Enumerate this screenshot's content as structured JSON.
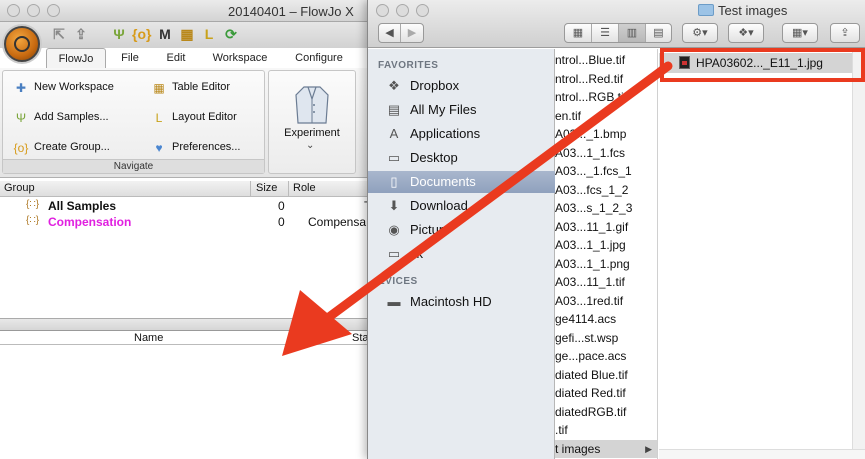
{
  "flowjo": {
    "title": "20140401 – FlowJo X",
    "tabs": [
      {
        "label": "FlowJo",
        "active": true
      },
      {
        "label": "File"
      },
      {
        "label": "Edit"
      },
      {
        "label": "Workspace"
      },
      {
        "label": "Configure"
      }
    ],
    "ribbon": {
      "left_items": [
        {
          "label": "New Workspace",
          "icon": "new-workspace-icon"
        },
        {
          "label": "Add Samples...",
          "icon": "add-samples-icon"
        },
        {
          "label": "Create Group...",
          "icon": "create-group-icon"
        }
      ],
      "right_items": [
        {
          "label": "Table Editor",
          "icon": "table-editor-icon"
        },
        {
          "label": "Layout Editor",
          "icon": "layout-editor-icon"
        },
        {
          "label": "Preferences...",
          "icon": "preferences-icon"
        }
      ],
      "panel_label": "Navigate",
      "experiment_label": "Experiment"
    },
    "grid": {
      "headers": {
        "group": "Group",
        "size": "Size",
        "role": "Role"
      },
      "rows": [
        {
          "name": "All Samples",
          "size": "0",
          "role": "T",
          "color": "#000000"
        },
        {
          "name": "Compensation",
          "size": "0",
          "role": "Compensa",
          "color": "#e020e0"
        }
      ]
    },
    "lower_headers": {
      "name": "Name",
      "status": "Sta"
    }
  },
  "finder": {
    "title": "Test images",
    "sidebar": {
      "favorites_label": "FAVORITES",
      "favorites": [
        {
          "label": "Dropbox",
          "icon": "dropbox-icon"
        },
        {
          "label": "All My Files",
          "icon": "all-my-files-icon"
        },
        {
          "label": "Applications",
          "icon": "applications-icon"
        },
        {
          "label": "Desktop",
          "icon": "desktop-icon"
        },
        {
          "label": "Documents",
          "icon": "documents-icon",
          "selected": true
        },
        {
          "label": "Download",
          "icon": "downloads-icon"
        },
        {
          "label": "Pictur",
          "icon": "pictures-icon"
        },
        {
          "label": "ck",
          "icon": "folder-icon"
        }
      ],
      "devices_label": "EVICES",
      "devices": [
        {
          "label": "Macintosh HD",
          "icon": "hard-drive-icon"
        }
      ]
    },
    "column1": [
      "ntrol...Blue.tif",
      "ntrol...Red.tif",
      "ntrol...RGB.tif",
      "en.tif",
      "A03..._1.bmp",
      "A03...1_1.fcs",
      "A03..._1.fcs_1",
      "A03...fcs_1_2",
      "A03...s_1_2_3",
      "A03...11_1.gif",
      "A03...1_1.jpg",
      "A03...1_1.png",
      "A03...11_1.tif",
      "A03...1red.tif",
      "ge4114.acs",
      "gefi...st.wsp",
      "ge...pace.acs",
      "diated Blue.tif",
      "diated Red.tif",
      "diatedRGB.tif",
      ".tif",
      "t images"
    ],
    "column2": [
      {
        "label": "HPA03602..._E11_1.jpg",
        "selected": true
      }
    ]
  }
}
